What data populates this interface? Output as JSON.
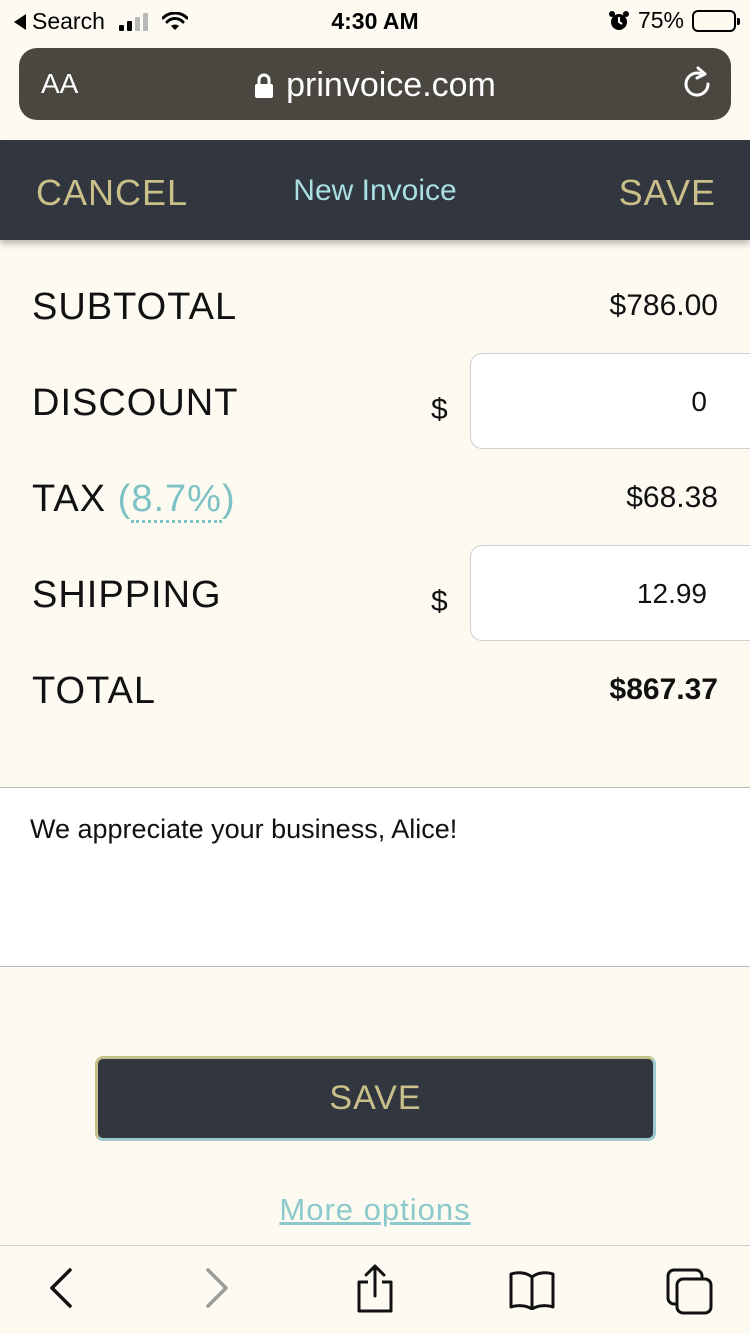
{
  "status_bar": {
    "back_label": "Search",
    "time": "4:30 AM",
    "battery": "75%"
  },
  "url_bar": {
    "text_size_label": "AA",
    "url": "prinvoice.com"
  },
  "header": {
    "cancel_label": "CANCEL",
    "title": "New Invoice",
    "save_label": "SAVE"
  },
  "totals": {
    "subtotal_label": "SUBTOTAL",
    "subtotal_value": "$786.00",
    "discount_label": "DISCOUNT",
    "discount_currency": "$",
    "discount_value": "0",
    "tax_label": "TAX",
    "tax_rate": "8.7%",
    "tax_value": "$68.38",
    "shipping_label": "SHIPPING",
    "shipping_currency": "$",
    "shipping_value": "12.99",
    "total_label": "TOTAL",
    "total_value": "$867.37"
  },
  "notes": {
    "text": "We appreciate your business, Alice!"
  },
  "actions": {
    "save_label": "SAVE",
    "more_options_label": "More options"
  },
  "colors": {
    "header_bg": "#32363f",
    "accent_gold": "#c9c08a",
    "accent_teal": "#7ec2c6",
    "page_bg": "#fdfbf1"
  }
}
